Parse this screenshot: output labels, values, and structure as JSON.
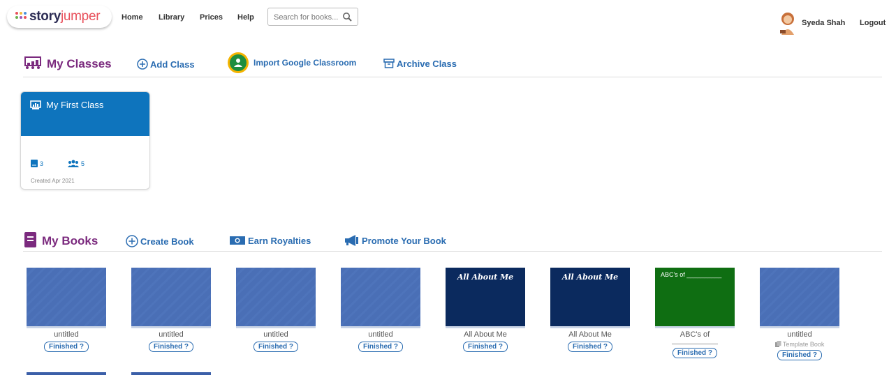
{
  "header": {
    "logo_main": "story",
    "logo_accent": "jumper",
    "nav": [
      "Home",
      "Library",
      "Prices",
      "Help"
    ],
    "search_placeholder": "Search for books...",
    "user_name": "Syeda Shah",
    "logout": "Logout"
  },
  "classes": {
    "title": "My Classes",
    "add_class": "Add Class",
    "import_google": "Import Google Classroom",
    "archive_class": "Archive Class",
    "card": {
      "name": "My First Class",
      "books_count": "3",
      "students_count": "5",
      "created": "Created Apr 2021"
    }
  },
  "books_section": {
    "title": "My Books",
    "create_book": "Create Book",
    "earn_royalties": "Earn Royalties",
    "promote": "Promote Your Book",
    "status_label": "Finished ?",
    "template_label": "Template Book",
    "items": [
      {
        "title": "untitled",
        "cover": "blue",
        "cover_text": ""
      },
      {
        "title": "untitled",
        "cover": "blue",
        "cover_text": ""
      },
      {
        "title": "untitled",
        "cover": "blue",
        "cover_text": ""
      },
      {
        "title": "untitled",
        "cover": "blue",
        "cover_text": ""
      },
      {
        "title": "All About Me",
        "cover": "navy",
        "cover_text": "All About Me"
      },
      {
        "title": "All About Me",
        "cover": "navy",
        "cover_text": "All About Me"
      },
      {
        "title": "ABC's of",
        "cover": "green",
        "cover_text": "ABC's of __________"
      },
      {
        "title": "untitled",
        "cover": "blue",
        "cover_text": ""
      }
    ]
  },
  "colors": {
    "brand_purple": "#7b2a7e",
    "link_blue": "#2a6cb1",
    "class_blue": "#0e74bd",
    "google_green": "#1e8e3e"
  }
}
